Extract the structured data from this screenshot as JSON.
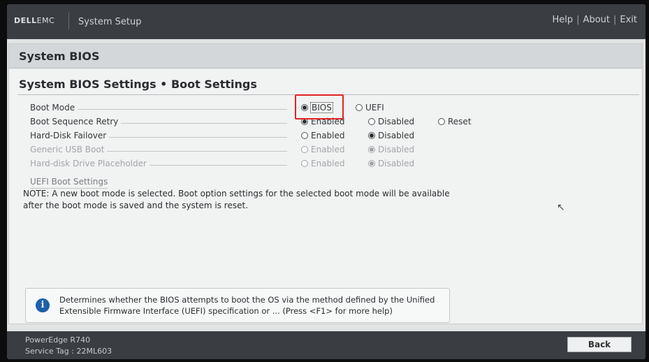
{
  "header": {
    "brand_dell": "DELL",
    "brand_emc": "EMC",
    "app_title": "System Setup",
    "links": [
      "Help",
      "About",
      "Exit"
    ]
  },
  "section_title": "System BIOS",
  "page_title": "System BIOS Settings • Boot Settings",
  "settings": [
    {
      "label": "Boot Mode",
      "enabled": true,
      "options": [
        {
          "text": "BIOS",
          "selected": true
        },
        {
          "text": "UEFI",
          "selected": false
        }
      ]
    },
    {
      "label": "Boot Sequence Retry",
      "enabled": true,
      "options": [
        {
          "text": "Enabled",
          "selected": true
        },
        {
          "text": "Disabled",
          "selected": false
        },
        {
          "text": "Reset",
          "selected": false
        }
      ]
    },
    {
      "label": "Hard-Disk Failover",
      "enabled": true,
      "options": [
        {
          "text": "Enabled",
          "selected": false
        },
        {
          "text": "Disabled",
          "selected": true
        }
      ]
    },
    {
      "label": "Generic USB Boot",
      "enabled": false,
      "options": [
        {
          "text": "Enabled",
          "selected": false
        },
        {
          "text": "Disabled",
          "selected": true
        }
      ]
    },
    {
      "label": "Hard-disk Drive Placeholder",
      "enabled": false,
      "options": [
        {
          "text": "Enabled",
          "selected": false
        },
        {
          "text": "Disabled",
          "selected": true
        }
      ]
    }
  ],
  "uefi_link": "UEFI Boot Settings",
  "note": "NOTE: A new boot mode is selected. Boot option settings for the selected boot mode will be available after the boot mode is saved and the system is reset.",
  "help_text": "Determines whether the BIOS attempts to boot the OS via the method defined by the Unified Extensible Firmware Interface (UEFI) specification or ... (Press <F1> for more help)",
  "footer": {
    "model": "PowerEdge R740",
    "service_tag": "Service Tag : 22ML603",
    "back_label": "Back"
  },
  "colors": {
    "highlight": "#e02424",
    "info_icon": "#1d5fa8"
  }
}
